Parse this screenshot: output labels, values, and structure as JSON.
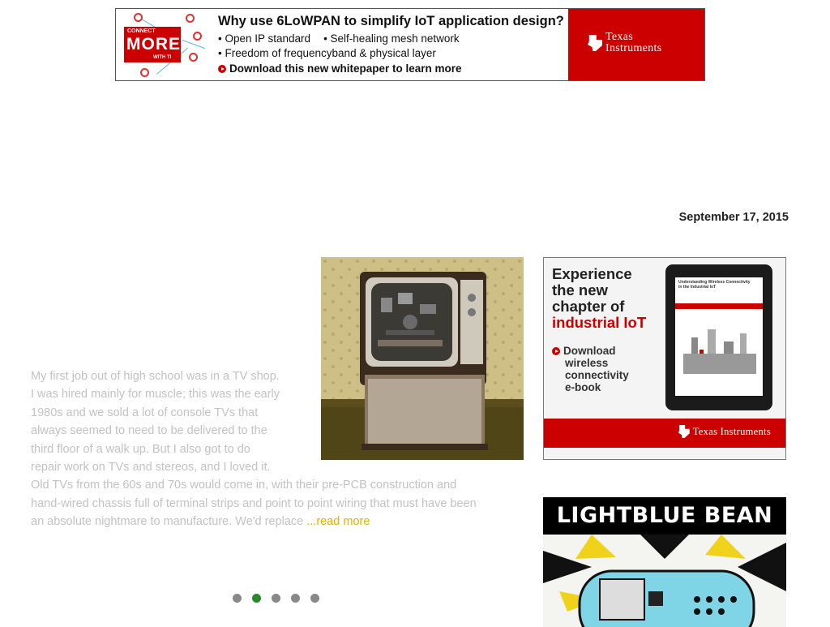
{
  "top_ad": {
    "badge_top": "CONNECT",
    "badge_main": "MORE",
    "badge_bottom": "WITH TI",
    "headline": "Why use 6LoWPAN to simplify IoT application design?",
    "bullet1": "• Open IP standard",
    "bullet2": "• Self-healing mesh network",
    "bullet3": "• Freedom of frequencyband & physical layer",
    "cta": "Download this new whitepaper to learn more",
    "brand_line1": "Texas",
    "brand_line2": "Instruments",
    "colors": {
      "brand_red": "#cc0000"
    }
  },
  "post": {
    "date": "September 17, 2015",
    "excerpt_lines": [
      "My first job out of high school was in a TV shop.",
      "I was hired mainly for muscle; this was the early",
      "1980s and we sold a lot of console TVs that",
      "always seemed to need to be delivered to the",
      "third floor of a walk up. But I also got to do",
      "repair work on TVs and stereos, and I loved it.",
      "Old TVs from the 60s and 70s would come in, with their pre-PCB construction and",
      "hand-wired chassis full of terminal strips and point to point wiring that must have been",
      "an absolute nightmare to manufacture. We'd replace "
    ],
    "read_more": "...read more",
    "colors": {
      "excerpt_text": "#c2c2c2",
      "link": "#e0b100"
    }
  },
  "carousel": {
    "count": 5,
    "active_index": 1,
    "colors": {
      "active": "#2a8a2a",
      "inactive": "#888888"
    }
  },
  "side_ad_iot": {
    "line1": "Experience",
    "line2": "the new",
    "line3": "chapter of",
    "line4": "industrial IoT",
    "dl1": "Download",
    "dl2": "wireless",
    "dl3": "connectivity",
    "dl4": "e-book",
    "screen_title1": "Understanding Wireless Connectivity",
    "screen_title2": "in the Industrial IoT",
    "brand": "Texas Instruments"
  },
  "side_ad_bean": {
    "title": "LIGHTBLUE BEAN"
  }
}
